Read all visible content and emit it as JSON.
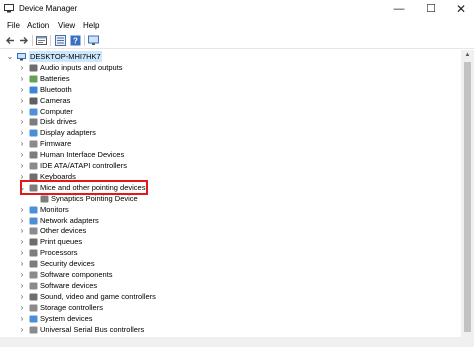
{
  "window": {
    "title": "Device Manager",
    "minimize": "—",
    "maximize": "☐",
    "close": "✕"
  },
  "menu": {
    "file": "File",
    "action": "Action",
    "view": "View",
    "help": "Help"
  },
  "toolbar": {
    "items": [
      "back-arrow-icon",
      "forward-arrow-icon",
      "properties-icon",
      "show-hidden-icon",
      "help-icon",
      "monitor-icon"
    ]
  },
  "tree": {
    "root": "DESKTOP-MHI7HK7",
    "categories": [
      {
        "label": "Audio inputs and outputs",
        "icon": "speaker-icon",
        "color": "#555555"
      },
      {
        "label": "Batteries",
        "icon": "battery-icon",
        "color": "#4a8f3a"
      },
      {
        "label": "Bluetooth",
        "icon": "bluetooth-icon",
        "color": "#1f6fd0"
      },
      {
        "label": "Cameras",
        "icon": "camera-icon",
        "color": "#444444"
      },
      {
        "label": "Computer",
        "icon": "computer-icon",
        "color": "#2f7fd1"
      },
      {
        "label": "Disk drives",
        "icon": "disk-drive-icon",
        "color": "#666666"
      },
      {
        "label": "Display adapters",
        "icon": "display-adapter-icon",
        "color": "#2c7bd0"
      },
      {
        "label": "Firmware",
        "icon": "firmware-icon",
        "color": "#777777"
      },
      {
        "label": "Human Interface Devices",
        "icon": "hid-icon",
        "color": "#666666"
      },
      {
        "label": "IDE ATA/ATAPI controllers",
        "icon": "ide-controller-icon",
        "color": "#777777"
      },
      {
        "label": "Keyboards",
        "icon": "keyboard-icon",
        "color": "#555555"
      },
      {
        "label": "Mice and other pointing devices",
        "icon": "mouse-icon",
        "color": "#666666"
      },
      {
        "label": "Synaptics Pointing Device",
        "icon": "mouse-icon",
        "color": "#666666",
        "child": true
      },
      {
        "label": "Monitors",
        "icon": "monitor-icon",
        "color": "#2c7bd0"
      },
      {
        "label": "Network adapters",
        "icon": "network-adapter-icon",
        "color": "#2c7bd0"
      },
      {
        "label": "Other devices",
        "icon": "other-devices-icon",
        "color": "#777777"
      },
      {
        "label": "Print queues",
        "icon": "printer-icon",
        "color": "#555555"
      },
      {
        "label": "Processors",
        "icon": "processor-icon",
        "color": "#666666"
      },
      {
        "label": "Security devices",
        "icon": "security-icon",
        "color": "#666666"
      },
      {
        "label": "Software components",
        "icon": "software-component-icon",
        "color": "#777777"
      },
      {
        "label": "Software devices",
        "icon": "software-device-icon",
        "color": "#777777"
      },
      {
        "label": "Sound, video and game controllers",
        "icon": "sound-icon",
        "color": "#555555"
      },
      {
        "label": "Storage controllers",
        "icon": "storage-controller-icon",
        "color": "#777777"
      },
      {
        "label": "System devices",
        "icon": "system-device-icon",
        "color": "#2c7bd0"
      },
      {
        "label": "Universal Serial Bus controllers",
        "icon": "usb-controller-icon",
        "color": "#777777"
      }
    ]
  },
  "highlight_color": "#e0191d"
}
